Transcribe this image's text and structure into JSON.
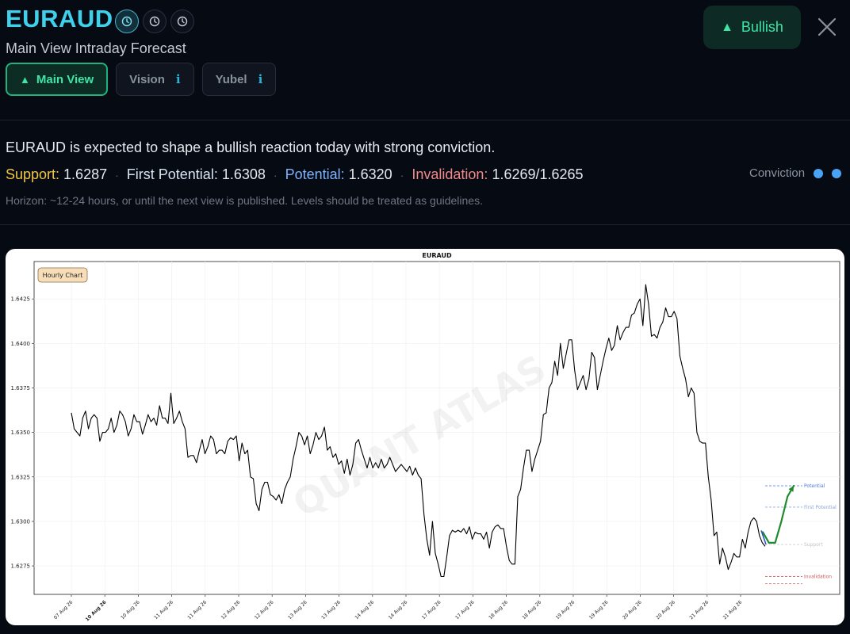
{
  "header": {
    "symbol": "EURAUD",
    "subtitle": "Main View Intraday Forecast",
    "timeframe_icons": [
      "clock-icon",
      "clock-icon",
      "clock-icon"
    ],
    "tabs": [
      {
        "label": "Main View",
        "active": true
      },
      {
        "label": "Vision",
        "active": false
      },
      {
        "label": "Yubel",
        "active": false
      }
    ],
    "bias_badge": "Bullish",
    "colors": {
      "accent": "#3fd0ec",
      "bullish": "#3ee6a6",
      "background": "#060a12"
    }
  },
  "summary": {
    "headline": "EURAUD is expected to shape a bullish reaction today with strong conviction.",
    "support_label": "Support:",
    "support_value": "1.6287",
    "first_potential_label": "First Potential:",
    "first_potential_value": "1.6308",
    "potential_label": "Potential:",
    "potential_value": "1.6320",
    "invalidation_label": "Invalidation:",
    "invalidation_value": "1.6269/1.6265",
    "conviction_label": "Conviction",
    "conviction_level": 2,
    "horizon": "Horizon: ~12-24 hours, or until the next view is published. Levels should be treated as guidelines.",
    "colors": {
      "support": "#f3c64a",
      "potential": "#7fb4ff",
      "invalidation": "#f08a8a"
    }
  },
  "chart_data": {
    "type": "line",
    "title": "EURAUD",
    "badge": "Hourly Chart",
    "watermark": "QUANT ATLAS",
    "xlabel": "",
    "ylabel": "",
    "ylim": [
      1.6259,
      1.6446
    ],
    "yticks": [
      "1.6275",
      "1.6300",
      "1.6325",
      "1.6350",
      "1.6375",
      "1.6400",
      "1.6425"
    ],
    "xticks": [
      "07 Aug 26",
      "10 Aug 26",
      "10 Aug 26",
      "11 Aug 26",
      "11 Aug 26",
      "12 Aug 26",
      "12 Aug 26",
      "13 Aug 26",
      "13 Aug 26",
      "14 Aug 26",
      "14 Aug 26",
      "17 Aug 26",
      "17 Aug 26",
      "18 Aug 26",
      "18 Aug 26",
      "19 Aug 26",
      "19 Aug 26",
      "20 Aug 26",
      "20 Aug 26",
      "21 Aug 26",
      "21 Aug 26"
    ],
    "bold_tick": 1,
    "grid": true,
    "series": [
      {
        "values": [
          1.6361,
          1.6352,
          1.635,
          1.6348,
          1.6358,
          1.6362,
          1.6352,
          1.6358,
          1.636,
          1.6358,
          1.6345,
          1.635,
          1.635,
          1.6352,
          1.6358,
          1.635,
          1.6354,
          1.6362,
          1.636,
          1.6356,
          1.6348,
          1.6352,
          1.636,
          1.6356,
          1.6356,
          1.6349,
          1.6354,
          1.636,
          1.6356,
          1.6358,
          1.6354,
          1.6365,
          1.6358,
          1.6358,
          1.6355,
          1.6372,
          1.6355,
          1.6358,
          1.6362,
          1.6356,
          1.6352,
          1.6336,
          1.6337,
          1.6337,
          1.6333,
          1.634,
          1.6346,
          1.6338,
          1.6342,
          1.6348,
          1.6346,
          1.6338,
          1.634,
          1.634,
          1.6338,
          1.6345,
          1.6347,
          1.6346,
          1.6348,
          1.6334,
          1.6344,
          1.6338,
          1.634,
          1.6325,
          1.6324,
          1.631,
          1.6306,
          1.6318,
          1.6322,
          1.6322,
          1.6315,
          1.6314,
          1.6312,
          1.6315,
          1.631,
          1.6318,
          1.6322,
          1.6325,
          1.6335,
          1.6342,
          1.635,
          1.6348,
          1.6343,
          1.6348,
          1.6338,
          1.6343,
          1.635,
          1.6346,
          1.6348,
          1.6353,
          1.634,
          1.6342,
          1.6336,
          1.6338,
          1.6332,
          1.6334,
          1.6327,
          1.6335,
          1.6326,
          1.6332,
          1.6344,
          1.6346,
          1.634,
          1.6335,
          1.633,
          1.6336,
          1.633,
          1.6333,
          1.633,
          1.6335,
          1.633,
          1.6332,
          1.6336,
          1.6332,
          1.6328,
          1.633,
          1.6332,
          1.633,
          1.6328,
          1.6331,
          1.6326,
          1.633,
          1.6326,
          1.6324,
          1.6304,
          1.629,
          1.6281,
          1.63,
          1.6282,
          1.6276,
          1.6269,
          1.6269,
          1.628,
          1.6292,
          1.6295,
          1.6294,
          1.6295,
          1.6294,
          1.6296,
          1.6293,
          1.6297,
          1.629,
          1.6294,
          1.6293,
          1.6293,
          1.629,
          1.6294,
          1.6285,
          1.6294,
          1.6297,
          1.6298,
          1.6296,
          1.6296,
          1.6286,
          1.6278,
          1.6276,
          1.6276,
          1.6314,
          1.6318,
          1.633,
          1.634,
          1.634,
          1.6328,
          1.6335,
          1.634,
          1.6345,
          1.636,
          1.6361,
          1.6375,
          1.6378,
          1.639,
          1.6382,
          1.64,
          1.6386,
          1.6394,
          1.6402,
          1.6402,
          1.6385,
          1.6374,
          1.6378,
          1.6382,
          1.6374,
          1.638,
          1.6395,
          1.6392,
          1.6374,
          1.6382,
          1.639,
          1.6397,
          1.6403,
          1.6396,
          1.6399,
          1.641,
          1.6402,
          1.6406,
          1.6409,
          1.6409,
          1.6416,
          1.6417,
          1.6422,
          1.6425,
          1.641,
          1.6433,
          1.6422,
          1.6404,
          1.6405,
          1.6403,
          1.6409,
          1.6412,
          1.642,
          1.6415,
          1.6415,
          1.6418,
          1.6414,
          1.6393,
          1.6386,
          1.638,
          1.637,
          1.6375,
          1.6372,
          1.635,
          1.6345,
          1.6344,
          1.6344,
          1.6325,
          1.6312,
          1.6292,
          1.6294,
          1.6276,
          1.6285,
          1.628,
          1.6273,
          1.6277,
          1.6282,
          1.628,
          1.628,
          1.629,
          1.6285,
          1.6294,
          1.63,
          1.6302,
          1.63,
          1.6292,
          1.6288,
          1.6286
        ]
      }
    ],
    "forecast_path": [
      1.6294,
      1.6288,
      1.6288,
      1.63,
      1.6314,
      1.632
    ],
    "levels": [
      {
        "label": "Potential",
        "value": 1.632,
        "color": "#4a78d8"
      },
      {
        "label": "First Potential",
        "value": 1.6308,
        "color": "#8aa8d8"
      },
      {
        "label": "Support",
        "value": 1.6287,
        "color": "#bfc4cc"
      },
      {
        "label": "Invalidation",
        "value": 1.6269,
        "color": "#d05a5a"
      },
      {
        "label": "",
        "value": 1.6265,
        "color": "#d05a5a"
      }
    ]
  }
}
